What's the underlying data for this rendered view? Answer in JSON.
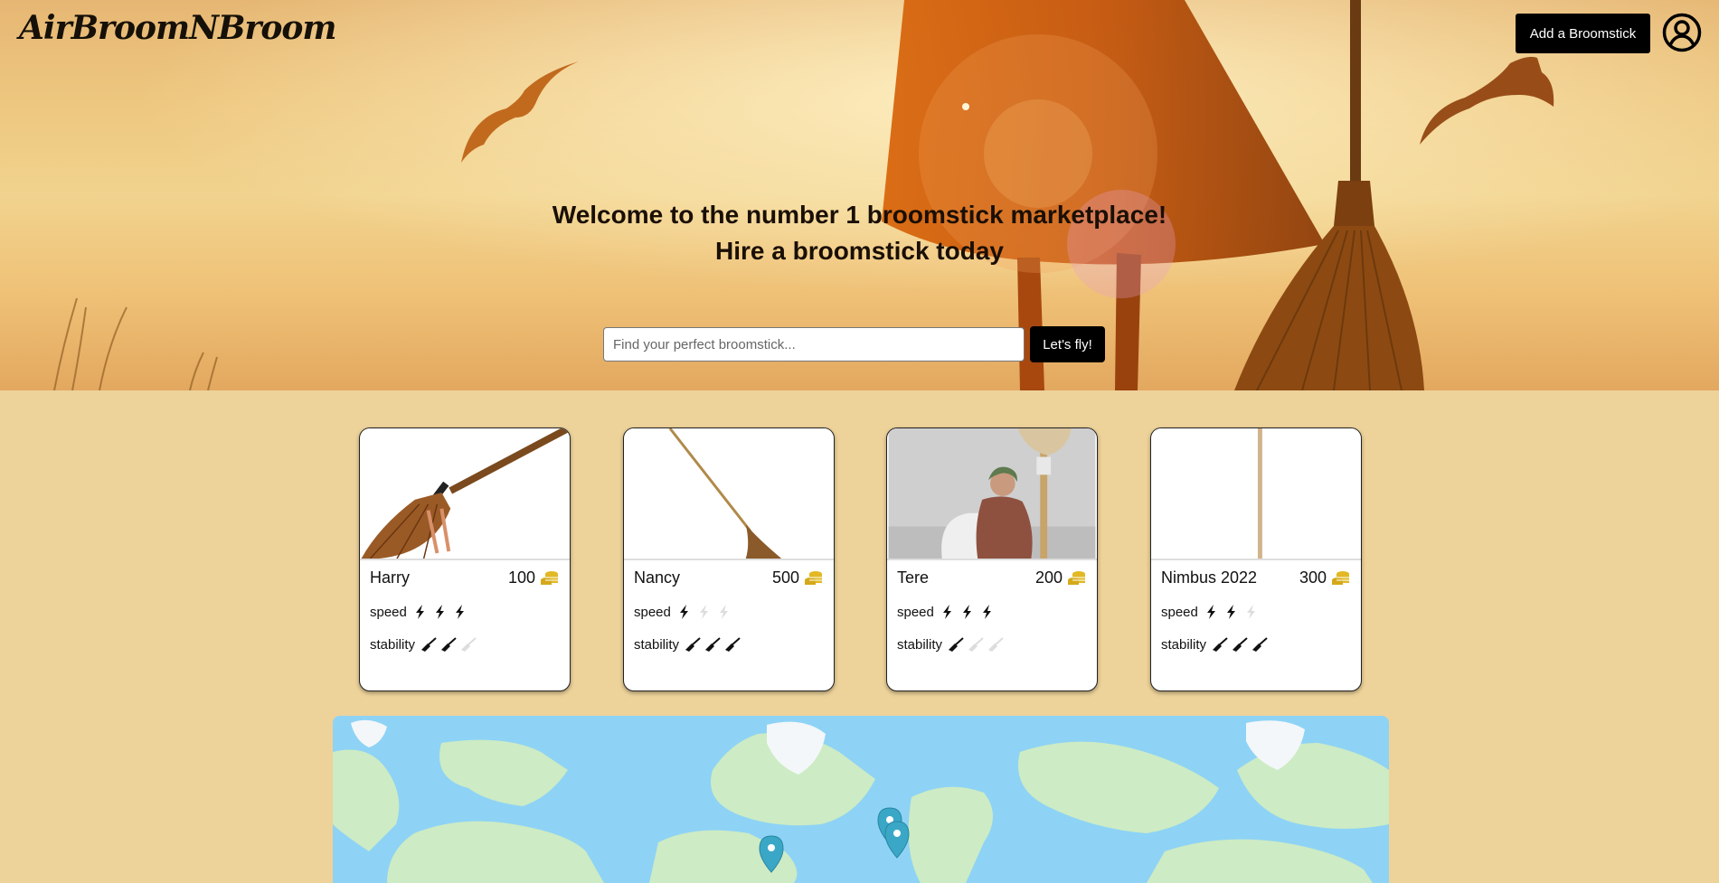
{
  "header": {
    "logo": "AirBroomNBroom",
    "add_button": "Add a Broomstick",
    "profile_icon": "user-circle-icon"
  },
  "hero": {
    "headline_line1": "Welcome to the number 1 broomstick marketplace!",
    "headline_line2": "Hire a broomstick today",
    "search_placeholder": "Find your perfect broomstick...",
    "search_button": "Let's fly!"
  },
  "cards": [
    {
      "name": "Harry",
      "price": "100",
      "speed_label": "speed",
      "speed": 3,
      "stability_label": "stability",
      "stability": 2
    },
    {
      "name": "Nancy",
      "price": "500",
      "speed_label": "speed",
      "speed": 1,
      "stability_label": "stability",
      "stability": 3
    },
    {
      "name": "Tere",
      "price": "200",
      "speed_label": "speed",
      "speed": 3,
      "stability_label": "stability",
      "stability": 1
    },
    {
      "name": "Nimbus 2022",
      "price": "300",
      "speed_label": "speed",
      "speed": 2,
      "stability_label": "stability",
      "stability": 3
    }
  ],
  "icons": {
    "price": "coin-stack-icon",
    "speed": "lightning-icon",
    "stability": "broom-icon",
    "map_marker": "map-pin-icon"
  },
  "colors": {
    "page_bg": "#EDD29A",
    "button_bg": "#000000",
    "coin": "#E2B824",
    "map_water": "#8ED3F5",
    "map_land": "#CDEBC4",
    "marker": "#3AA7C7"
  }
}
